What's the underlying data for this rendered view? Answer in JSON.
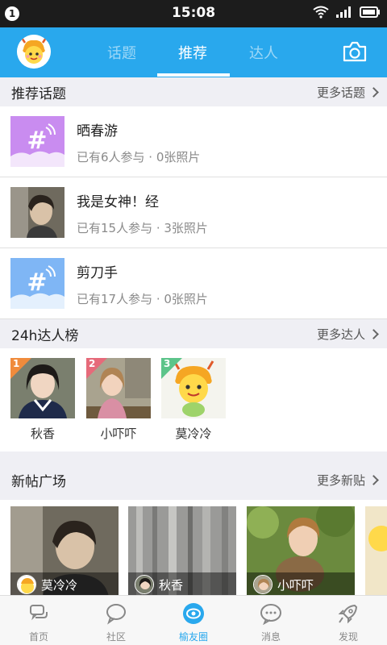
{
  "status_bar": {
    "notification_count": "1",
    "time": "15:08"
  },
  "top_nav": {
    "tabs": [
      {
        "label": "话题",
        "active": false
      },
      {
        "label": "推荐",
        "active": true
      },
      {
        "label": "达人",
        "active": false
      }
    ],
    "accent_color": "#29a8ed"
  },
  "topics_section": {
    "title": "推荐话题",
    "more": "更多话题",
    "items": [
      {
        "name": "晒春游",
        "meta": "已有6人参与 · 0张照片",
        "thumb": "hashtag-purple"
      },
      {
        "name": "我是女神！经",
        "meta": "已有15人参与 · 3张照片",
        "thumb": "photo"
      },
      {
        "name": "剪刀手",
        "meta": "已有17人参与 · 0张照片",
        "thumb": "hashtag-blue"
      }
    ]
  },
  "talent_section": {
    "title": "24h达人榜",
    "more": "更多达人",
    "items": [
      {
        "rank": "1",
        "name": "秋香"
      },
      {
        "rank": "2",
        "name": "小吓吓"
      },
      {
        "rank": "3",
        "name": "莫冷冷"
      }
    ]
  },
  "posts_section": {
    "title": "新帖广场",
    "more": "更多新贴",
    "items": [
      {
        "author": "莫冷冷"
      },
      {
        "author": "秋香"
      },
      {
        "author": "小吓吓"
      }
    ]
  },
  "bottom_nav": {
    "items": [
      {
        "label": "首页",
        "icon": "home-chat-icon",
        "active": false
      },
      {
        "label": "社区",
        "icon": "chat-bubble-icon",
        "active": false
      },
      {
        "label": "榆友圈",
        "icon": "eye-circle-icon",
        "active": true
      },
      {
        "label": "消息",
        "icon": "message-dots-icon",
        "active": false
      },
      {
        "label": "发现",
        "icon": "rocket-icon",
        "active": false
      }
    ]
  }
}
